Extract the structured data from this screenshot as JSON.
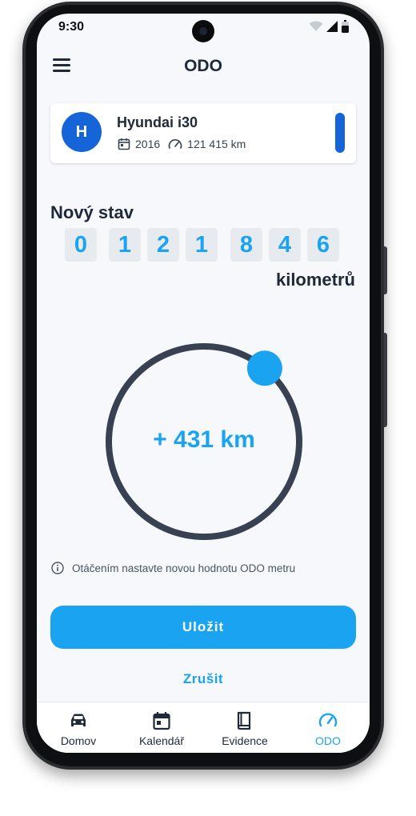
{
  "status_bar": {
    "time": "9:30"
  },
  "app_bar": {
    "title": "ODO"
  },
  "vehicle": {
    "initial": "H",
    "name": "Hyundai i30",
    "year": "2016",
    "mileage": "121 415 km"
  },
  "new_reading": {
    "title": "Nový stav",
    "digits": [
      "0",
      "1",
      "2",
      "1",
      "8",
      "4",
      "6"
    ],
    "unit": "kilometrů"
  },
  "dial": {
    "delta_text": "+ 431 km",
    "knob_position_fraction": 0.11
  },
  "hint": {
    "text": "Otáčením nastavte novou hodnotu ODO metru"
  },
  "actions": {
    "save_label": "Uložit",
    "cancel_label": "Zrušit"
  },
  "bottom_nav": {
    "items": [
      {
        "label": "Domov",
        "icon": "car-icon"
      },
      {
        "label": "Kalendář",
        "icon": "calendar-icon"
      },
      {
        "label": "Evidence",
        "icon": "book-icon"
      },
      {
        "label": "ODO",
        "icon": "speedometer-icon",
        "active": true
      }
    ]
  },
  "colors": {
    "accent": "#1aa3f0",
    "primary_blue": "#1565d8",
    "dial_ring": "#374151",
    "background": "#f6f8fb"
  }
}
